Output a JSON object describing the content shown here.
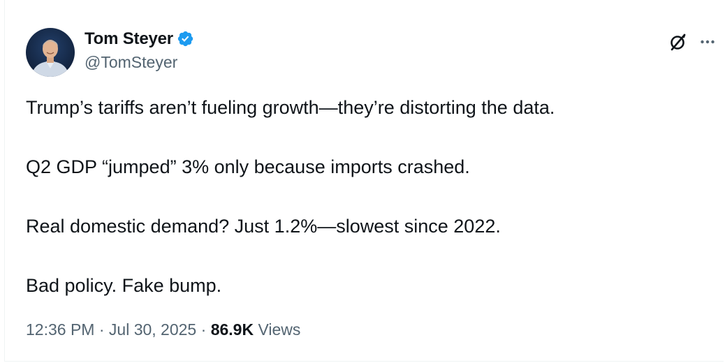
{
  "author": {
    "display_name": "Tom Steyer",
    "handle": "@TomSteyer",
    "verified": true,
    "avatar": "profile-photo"
  },
  "actions": {
    "grok_icon": "grok-icon",
    "more_icon": "more-icon"
  },
  "tweet": {
    "paragraphs": [
      "Trump’s tariffs aren’t fueling growth—they’re distorting the data.",
      "Q2 GDP “jumped” 3% only because imports crashed.",
      "Real domestic demand? Just 1.2%—slowest since 2022.",
      "Bad policy. Fake bump."
    ]
  },
  "meta": {
    "time": "12:36 PM",
    "separator": "·",
    "date": "Jul 30, 2025",
    "views_count": "86.9K",
    "views_label": "Views"
  },
  "colors": {
    "text_primary": "#0f1419",
    "text_secondary": "#536471",
    "verified_blue": "#1d9bf0"
  }
}
